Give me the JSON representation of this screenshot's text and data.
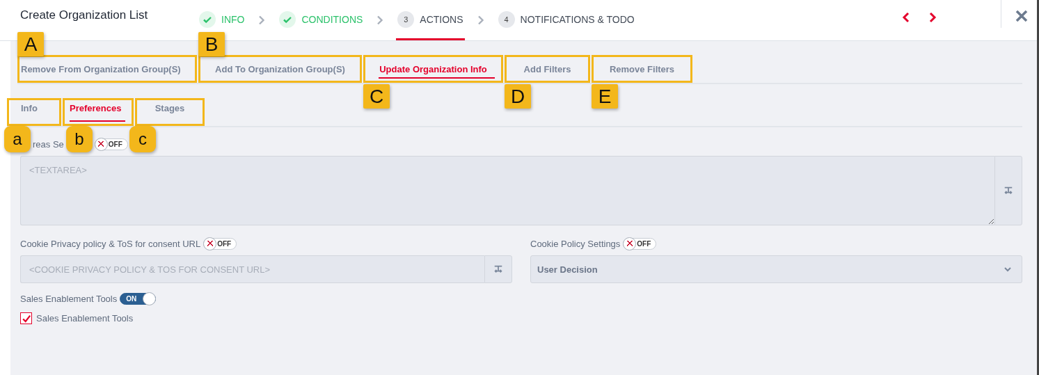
{
  "title": "Create Organization List",
  "steps": [
    {
      "kind": "done",
      "label": "INFO",
      "selected": false
    },
    {
      "kind": "done",
      "label": "CONDITIONS",
      "selected": false
    },
    {
      "kind": "numbered",
      "number": "3",
      "label": "ACTIONS",
      "selected": true
    },
    {
      "kind": "numbered",
      "number": "4",
      "label": "NOTIFICATIONS & TODO",
      "selected": false
    }
  ],
  "action_tabs": [
    {
      "label": "Remove From Organization Group(S)",
      "selected": false,
      "callout": {
        "letter": "A",
        "kind": "above"
      }
    },
    {
      "label": "Add To Organization Group(S)",
      "selected": false,
      "callout": {
        "letter": "B",
        "kind": "above"
      }
    },
    {
      "label": "Update Organization Info",
      "selected": true,
      "callout": {
        "letter": "C",
        "kind": "below"
      }
    },
    {
      "label": "Add Filters",
      "selected": false,
      "callout": {
        "letter": "D",
        "kind": "below"
      }
    },
    {
      "label": "Remove Filters",
      "selected": false,
      "callout": {
        "letter": "E",
        "kind": "below"
      }
    }
  ],
  "sub_tabs": [
    {
      "label": "Info",
      "selected": false,
      "callout": {
        "letter": "a",
        "kind": "below"
      }
    },
    {
      "label": "Preferences",
      "selected": true,
      "callout": {
        "letter": "b",
        "kind": "below"
      }
    },
    {
      "label": "Stages",
      "selected": false,
      "callout": {
        "letter": "c",
        "kind": "below"
      }
    }
  ],
  "areas": {
    "label": "reas Se",
    "toggle": {
      "on": false,
      "text": "OFF"
    },
    "placeholder": "<TEXTAREA>"
  },
  "cookie_url": {
    "label": "Cookie Privacy policy & ToS for consent URL",
    "toggle": {
      "on": false,
      "text": "OFF"
    },
    "placeholder": "<COOKIE PRIVACY POLICY & TOS FOR CONSENT URL>"
  },
  "cookie_policy": {
    "label": "Cookie Policy Settings",
    "toggle": {
      "on": false,
      "text": "OFF"
    },
    "value": "User Decision"
  },
  "sales": {
    "label": "Sales Enablement Tools",
    "toggle": {
      "on": true,
      "text": "ON"
    }
  },
  "sales_checkbox": {
    "label": "Sales Enablement Tools",
    "checked": true
  }
}
